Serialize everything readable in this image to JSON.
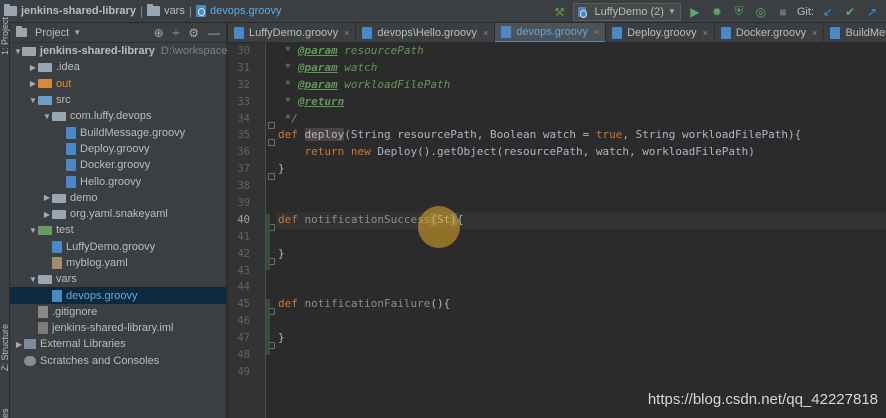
{
  "breadcrumb": {
    "project": "jenkins-shared-library",
    "folder": "vars",
    "file": "devops.groovy"
  },
  "toolbar": {
    "run_config": "LuffyDemo (2)",
    "git_label": "Git:"
  },
  "left_strip": {
    "project_tab": "1: Project",
    "structure_tab": "Z: Structure",
    "favorites_tab": "res"
  },
  "project_panel": {
    "title": "Project",
    "tree": [
      {
        "name": "jenkins-shared-library",
        "path": "D:\\workspace\\luffy",
        "type": "root",
        "depth": 0,
        "arrow": "▼"
      },
      {
        "name": ".idea",
        "type": "folder",
        "depth": 1,
        "arrow": "▶"
      },
      {
        "name": "out",
        "type": "folder-orange",
        "depth": 1,
        "arrow": "▶"
      },
      {
        "name": "src",
        "type": "folder-blue",
        "depth": 1,
        "arrow": "▼"
      },
      {
        "name": "com.luffy.devops",
        "type": "folder",
        "depth": 2,
        "arrow": "▼"
      },
      {
        "name": "BuildMessage.groovy",
        "type": "groovy",
        "depth": 3,
        "arrow": ""
      },
      {
        "name": "Deploy.groovy",
        "type": "groovy",
        "depth": 3,
        "arrow": ""
      },
      {
        "name": "Docker.groovy",
        "type": "groovy",
        "depth": 3,
        "arrow": ""
      },
      {
        "name": "Hello.groovy",
        "type": "groovy",
        "depth": 3,
        "arrow": ""
      },
      {
        "name": "demo",
        "type": "folder",
        "depth": 2,
        "arrow": "▶"
      },
      {
        "name": "org.yaml.snakeyaml",
        "type": "folder",
        "depth": 2,
        "arrow": "▶"
      },
      {
        "name": "test",
        "type": "folder-green",
        "depth": 1,
        "arrow": "▼"
      },
      {
        "name": "LuffyDemo.groovy",
        "type": "groovy",
        "depth": 2,
        "arrow": ""
      },
      {
        "name": "myblog.yaml",
        "type": "yaml",
        "depth": 2,
        "arrow": ""
      },
      {
        "name": "vars",
        "type": "folder",
        "depth": 1,
        "arrow": "▼"
      },
      {
        "name": "devops.groovy",
        "type": "groovy",
        "depth": 2,
        "arrow": "",
        "selected": true
      },
      {
        "name": ".gitignore",
        "type": "git",
        "depth": 1,
        "arrow": ""
      },
      {
        "name": "jenkins-shared-library.iml",
        "type": "iml",
        "depth": 1,
        "arrow": ""
      },
      {
        "name": "External Libraries",
        "type": "lib",
        "depth": 0,
        "arrow": "▶"
      },
      {
        "name": "Scratches and Consoles",
        "type": "scratch",
        "depth": 0,
        "arrow": ""
      }
    ]
  },
  "tabs": [
    {
      "label": "LuffyDemo.groovy",
      "active": false
    },
    {
      "label": "devops\\Hello.groovy",
      "active": false
    },
    {
      "label": "devops.groovy",
      "active": true
    },
    {
      "label": "Deploy.groovy",
      "active": false
    },
    {
      "label": "Docker.groovy",
      "active": false
    },
    {
      "label": "BuildMessage.groov",
      "active": false
    }
  ],
  "editor": {
    "current_line": 40,
    "lines": [
      {
        "n": 30,
        "segs": [
          {
            "t": " * ",
            "c": "doc"
          },
          {
            "t": "@param",
            "c": "doc-tag"
          },
          {
            "t": " resourcePath",
            "c": "doc"
          }
        ]
      },
      {
        "n": 31,
        "segs": [
          {
            "t": " * ",
            "c": "doc"
          },
          {
            "t": "@param",
            "c": "doc-tag"
          },
          {
            "t": " watch",
            "c": "doc"
          }
        ]
      },
      {
        "n": 32,
        "segs": [
          {
            "t": " * ",
            "c": "doc"
          },
          {
            "t": "@param",
            "c": "doc-tag"
          },
          {
            "t": " workloadFilePath",
            "c": "doc"
          }
        ]
      },
      {
        "n": 33,
        "segs": [
          {
            "t": " * ",
            "c": "doc"
          },
          {
            "t": "@return",
            "c": "doc-tag"
          }
        ]
      },
      {
        "n": 34,
        "segs": [
          {
            "t": " */",
            "c": "doc"
          }
        ]
      },
      {
        "n": 35,
        "segs": [
          {
            "t": "def ",
            "c": "kw"
          },
          {
            "t": "deploy",
            "c": "fn-hl"
          },
          {
            "t": "(String resourcePath, Boolean watch = ",
            "c": ""
          },
          {
            "t": "true",
            "c": "kw"
          },
          {
            "t": ", String workloadFilePath){",
            "c": ""
          }
        ]
      },
      {
        "n": 36,
        "segs": [
          {
            "t": "    ",
            "c": ""
          },
          {
            "t": "return ",
            "c": "kw"
          },
          {
            "t": "new ",
            "c": "kw"
          },
          {
            "t": "Deploy().getObject(resourcePath, watch, workloadFilePath)",
            "c": ""
          }
        ]
      },
      {
        "n": 37,
        "segs": [
          {
            "t": "}",
            "c": ""
          }
        ]
      },
      {
        "n": 38,
        "segs": []
      },
      {
        "n": 39,
        "segs": []
      },
      {
        "n": 40,
        "segs": [
          {
            "t": "def ",
            "c": "kw"
          },
          {
            "t": "notificationSuccess",
            "c": "fn-unused"
          },
          {
            "t": "(",
            "c": "caret-hl"
          },
          {
            "t": "St",
            "c": ""
          },
          {
            "t": ")",
            "c": "caret-hl"
          },
          {
            "t": "{",
            "c": ""
          }
        ]
      },
      {
        "n": 41,
        "segs": []
      },
      {
        "n": 42,
        "segs": [
          {
            "t": "}",
            "c": ""
          }
        ]
      },
      {
        "n": 43,
        "segs": []
      },
      {
        "n": 44,
        "segs": []
      },
      {
        "n": 45,
        "segs": [
          {
            "t": "def ",
            "c": "kw"
          },
          {
            "t": "notificationFailure",
            "c": "fn-unused"
          },
          {
            "t": "(){",
            "c": ""
          }
        ]
      },
      {
        "n": 46,
        "segs": []
      },
      {
        "n": 47,
        "segs": [
          {
            "t": "}",
            "c": ""
          }
        ]
      },
      {
        "n": 48,
        "segs": []
      },
      {
        "n": 49,
        "segs": []
      }
    ]
  },
  "watermark": "https://blog.csdn.net/qq_42227818",
  "colors": {
    "background": "#2b2b2b",
    "panel": "#3c3f41",
    "keyword": "#cc7832",
    "doc_comment": "#629755",
    "selection": "#0d293e",
    "accent": "#5fa9e8"
  }
}
